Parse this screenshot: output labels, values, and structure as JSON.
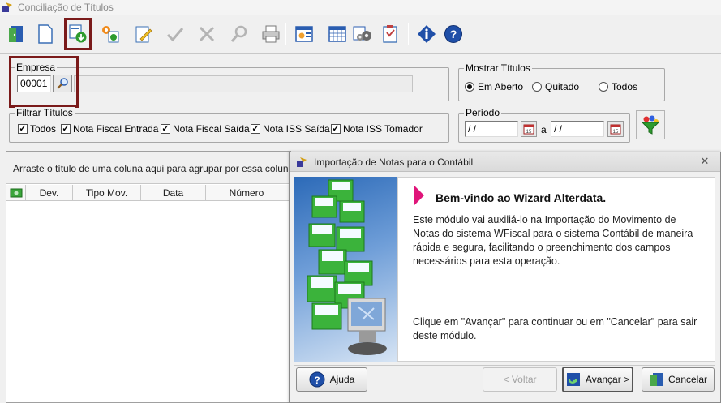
{
  "window": {
    "title": "Conciliação de Títulos"
  },
  "toolbar": {
    "buttons": [
      {
        "icon": "exit-door-icon"
      },
      {
        "icon": "new-document-icon"
      },
      {
        "icon": "import-notes-icon",
        "active": true
      },
      {
        "icon": "auto-process-icon"
      },
      {
        "icon": "edit-document-icon"
      },
      {
        "icon": "check-icon"
      },
      {
        "icon": "cancel-x-icon"
      },
      {
        "icon": "search-magnifier-icon"
      },
      {
        "icon": "printer-icon"
      },
      {
        "icon": "report-window-icon"
      },
      {
        "icon": "calendar-grid-icon"
      },
      {
        "icon": "settings-gears-icon"
      },
      {
        "icon": "clipboard-icon"
      },
      {
        "icon": "info-icon"
      },
      {
        "icon": "help-icon"
      }
    ]
  },
  "empresa": {
    "label": "Empresa",
    "code": "00001"
  },
  "mostrar": {
    "label": "Mostrar Títulos",
    "options": [
      "Em Aberto",
      "Quitado",
      "Todos"
    ],
    "selected": "Em Aberto"
  },
  "filtrar": {
    "label": "Filtrar Títulos",
    "options": [
      "Todos",
      "Nota Fiscal Entrada",
      "Nota Fiscal Saída",
      "Nota ISS Saída",
      "Nota ISS Tomador"
    ]
  },
  "periodo": {
    "label": "Período",
    "from": " / /",
    "to": " / /",
    "separator": "a"
  },
  "grid": {
    "group_hint": "Arraste o título de uma coluna aqui para agrupar por essa coluna",
    "columns": [
      "Dev.",
      "Tipo Mov.",
      "Data",
      "Número"
    ]
  },
  "dialog": {
    "title": "Importação de Notas para o Contábil",
    "heading": "Bem-vindo ao Wizard Alterdata.",
    "body": "Este módulo vai auxiliá-lo na Importação do Movimento de Notas do sistema WFiscal para o sistema Contábil de maneira rápida e segura, facilitando o preenchimento dos campos necessários para esta operação.",
    "footer": "Clique em \"Avançar\" para continuar ou em \"Cancelar\" para sair deste módulo.",
    "buttons": {
      "help": "Ajuda",
      "back": "< Voltar",
      "next": "Avançar >",
      "cancel": "Cancelar"
    }
  },
  "colors": {
    "accent": "#e0157a",
    "highlight": "#7a1a1a",
    "icon_blue": "#2a5db0",
    "icon_green": "#2e9b2e"
  }
}
